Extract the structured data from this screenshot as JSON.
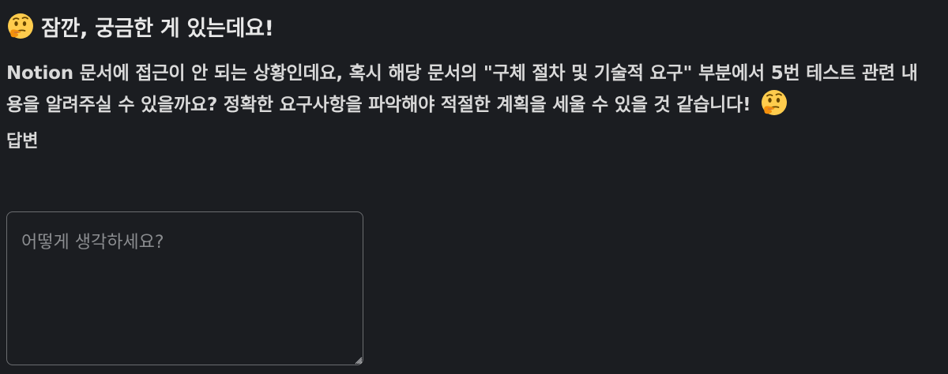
{
  "header": {
    "icon": "thinking-face-icon",
    "title": "잠깐, 궁금한 게 있는데요!"
  },
  "message": {
    "text": "Notion 문서에 접근이 안 되는 상황인데요, 혹시 해당 문서의 \"구체 절차 및 기술적 요구\" 부분에서 5번 테스트 관련 내용을 알려주실 수 있을까요? 정확한 요구사항을 파악해야 적절한 계획을 세울 수 있을 것 같습니다!",
    "trailing_icon": "thinking-face-icon"
  },
  "answer": {
    "label": "답변",
    "placeholder": "어떻게 생각하세요?",
    "value": ""
  },
  "colors": {
    "background": "#1b1d21",
    "text": "#d9d9d9",
    "border": "#6b6d70",
    "placeholder": "#8b8d90"
  }
}
